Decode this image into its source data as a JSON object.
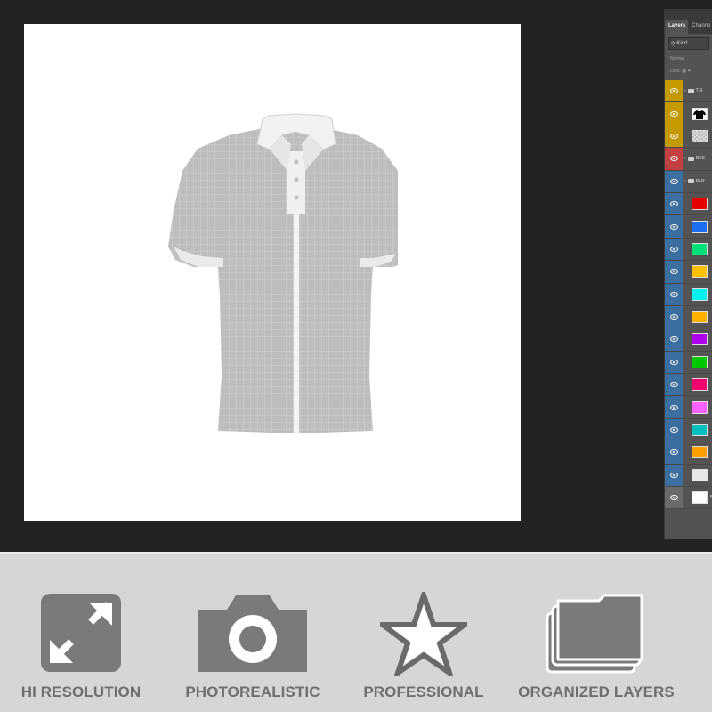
{
  "layers_panel": {
    "tabs": [
      {
        "label": "Layers",
        "active": true
      },
      {
        "label": "Channe",
        "active": false
      }
    ],
    "filter": {
      "icon": "search-icon",
      "value": "Kind"
    },
    "blend_mode": "Normal",
    "lock_label": "Lock:",
    "layers": [
      {
        "kind": "group",
        "eye_color": "#c49a00",
        "name": "T-S"
      },
      {
        "kind": "layer",
        "eye_color": "#c49a00",
        "thumb": "#000000",
        "thumb_type": "shirt"
      },
      {
        "kind": "layer",
        "eye_color": "#c49a00",
        "thumb": "checker",
        "thumb_type": "checker"
      },
      {
        "kind": "group",
        "eye_color": "#c24040",
        "name": "DES"
      },
      {
        "kind": "group",
        "eye_color": "#3d6ea0",
        "name": "PAR"
      },
      {
        "kind": "layer",
        "eye_color": "#3d6ea0",
        "thumb": "#e60000"
      },
      {
        "kind": "layer",
        "eye_color": "#3d6ea0",
        "thumb": "#1e6ef0"
      },
      {
        "kind": "layer",
        "eye_color": "#3d6ea0",
        "thumb": "#00e07a"
      },
      {
        "kind": "layer",
        "eye_color": "#3d6ea0",
        "thumb": "#ffc000"
      },
      {
        "kind": "layer",
        "eye_color": "#3d6ea0",
        "thumb": "#00f0f0"
      },
      {
        "kind": "layer",
        "eye_color": "#3d6ea0",
        "thumb": "#ffb000"
      },
      {
        "kind": "layer",
        "eye_color": "#3d6ea0",
        "thumb": "#b000f0"
      },
      {
        "kind": "layer",
        "eye_color": "#3d6ea0",
        "thumb": "#00c800"
      },
      {
        "kind": "layer",
        "eye_color": "#3d6ea0",
        "thumb": "#f0006e"
      },
      {
        "kind": "layer",
        "eye_color": "#3d6ea0",
        "thumb": "#ff60ff"
      },
      {
        "kind": "layer",
        "eye_color": "#3d6ea0",
        "thumb": "#00c0c0"
      },
      {
        "kind": "layer",
        "eye_color": "#3d6ea0",
        "thumb": "#ffa000"
      },
      {
        "kind": "layer",
        "eye_color": "#3d6ea0",
        "thumb": "#e8e8e8"
      },
      {
        "kind": "layer",
        "eye_color": "#6a6a6a",
        "thumb": "#ffffff",
        "name": "BA"
      }
    ]
  },
  "features": [
    {
      "icon": "expand-arrows-icon",
      "label": "HI RESOLUTION"
    },
    {
      "icon": "camera-icon",
      "label": "PHOTOREALISTIC"
    },
    {
      "icon": "star-icon",
      "label": "PROFESSIONAL"
    },
    {
      "icon": "layers-stack-icon",
      "label": "ORGANIZED LAYERS"
    }
  ],
  "colors": {
    "workspace_bg": "#232323",
    "canvas_bg": "#ffffff",
    "panel_bg": "#535353",
    "banner_bg": "#d6d6d6",
    "feature_icon": "#7a7a7a",
    "feature_text": "#6f6f6f"
  }
}
